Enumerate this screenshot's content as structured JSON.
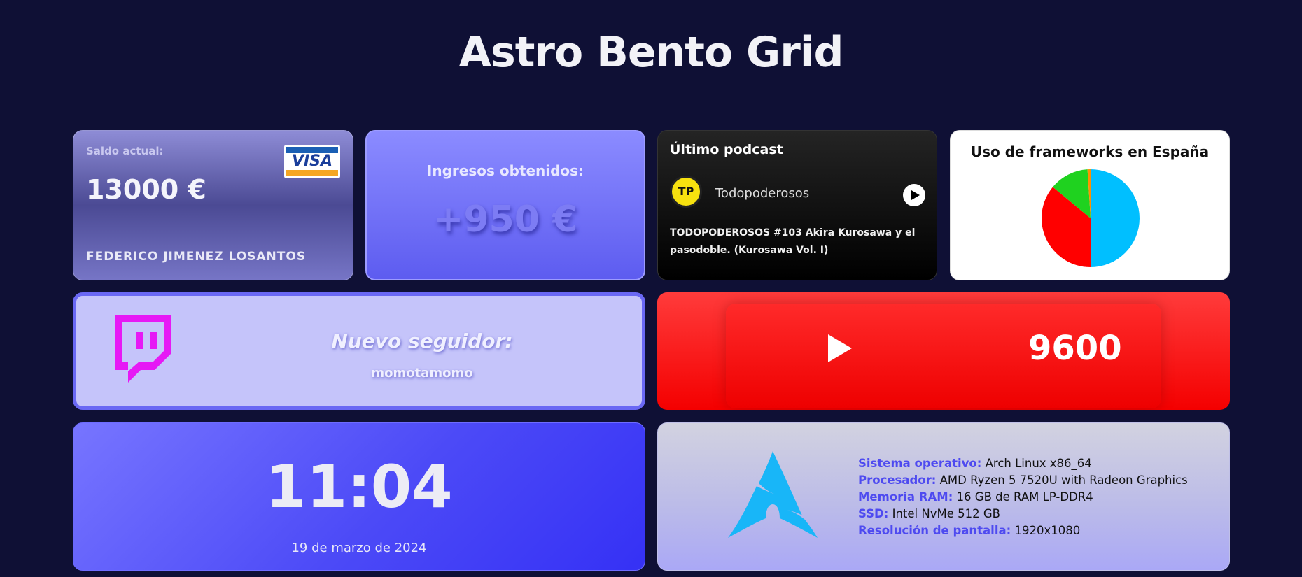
{
  "page": {
    "title": "Astro Bento Grid"
  },
  "bank": {
    "label": "Saldo actual:",
    "amount": "13000 €",
    "holder": "FEDERICO JIMENEZ LOSANTOS",
    "card_brand": "VISA"
  },
  "income": {
    "label": "Ingresos obtenidos:",
    "value": "+950 €"
  },
  "podcast": {
    "heading": "Último podcast",
    "logo_text": "TP",
    "show_name": "Todopoderosos",
    "episode": "TODOPODEROSOS #103 Akira Kurosawa y el pasodoble. (Kurosawa Vol. I)",
    "play_icon": "play-circle-icon"
  },
  "frameworks": {
    "heading": "Uso de frameworks en España",
    "chart_data": {
      "type": "pie",
      "title": "Uso de frameworks en España",
      "slices": [
        {
          "value": 50,
          "color": "#00bfff"
        },
        {
          "value": 36,
          "color": "#ff0000"
        },
        {
          "value": 13,
          "color": "#1fd21f"
        },
        {
          "value": 1,
          "color": "#ff9000"
        }
      ]
    }
  },
  "twitch": {
    "label": "Nuevo seguidor:",
    "user": "momotamomo",
    "icon": "twitch-icon"
  },
  "youtube": {
    "count": "9600",
    "icon": "youtube-play-icon"
  },
  "clock": {
    "time": "11:04",
    "date": "19 de marzo de 2024"
  },
  "system": {
    "icon": "arch-linux-icon",
    "specs": [
      {
        "key": "Sistema operativo:",
        "value": "Arch Linux x86_64"
      },
      {
        "key": "Procesador:",
        "value": "AMD Ryzen 5 7520U with Radeon Graphics"
      },
      {
        "key": "Memoria RAM:",
        "value": "16 GB de RAM LP-DDR4"
      },
      {
        "key": "SSD:",
        "value": "Intel NvMe 512 GB"
      },
      {
        "key": "Resolución de pantalla:",
        "value": "1920x1080"
      }
    ]
  },
  "colors": {
    "background": "#0f1035",
    "accent": "#5d5cf0",
    "youtube_red": "#ff0000",
    "twitch_purple": "#e619f5"
  }
}
